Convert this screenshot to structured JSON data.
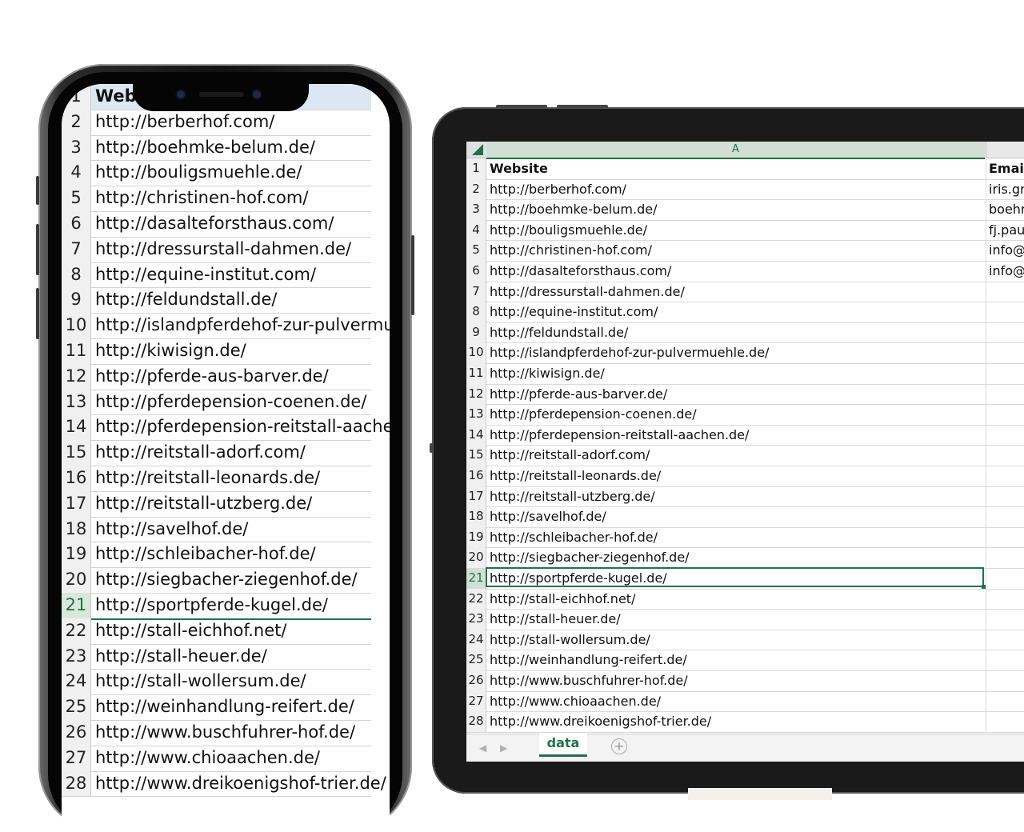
{
  "spreadsheet": {
    "column_letter": "A",
    "header": {
      "row": "1",
      "website": "Website",
      "email": "Email"
    },
    "rows": [
      {
        "num": "2",
        "website": "http://berberhof.com/",
        "email": "iris.gr"
      },
      {
        "num": "3",
        "website": "http://boehmke-belum.de/",
        "email": "boehr"
      },
      {
        "num": "4",
        "website": "http://bouligsmuehle.de/",
        "email": "fj.pau"
      },
      {
        "num": "5",
        "website": "http://christinen-hof.com/",
        "email": "info@"
      },
      {
        "num": "6",
        "website": "http://dasalteforsthaus.com/",
        "email": "info@"
      },
      {
        "num": "7",
        "website": "http://dressurstall-dahmen.de/",
        "email": ""
      },
      {
        "num": "8",
        "website": "http://equine-institut.com/",
        "email": ""
      },
      {
        "num": "9",
        "website": "http://feldundstall.de/",
        "email": ""
      },
      {
        "num": "10",
        "website": "http://islandpferdehof-zur-pulvermuehle.de/",
        "email": ""
      },
      {
        "num": "11",
        "website": "http://kiwisign.de/",
        "email": ""
      },
      {
        "num": "12",
        "website": "http://pferde-aus-barver.de/",
        "email": ""
      },
      {
        "num": "13",
        "website": "http://pferdepension-coenen.de/",
        "email": ""
      },
      {
        "num": "14",
        "website": "http://pferdepension-reitstall-aachen.de/",
        "email": ""
      },
      {
        "num": "15",
        "website": "http://reitstall-adorf.com/",
        "email": ""
      },
      {
        "num": "16",
        "website": "http://reitstall-leonards.de/",
        "email": ""
      },
      {
        "num": "17",
        "website": "http://reitstall-utzberg.de/",
        "email": ""
      },
      {
        "num": "18",
        "website": "http://savelhof.de/",
        "email": ""
      },
      {
        "num": "19",
        "website": "http://schleibacher-hof.de/",
        "email": ""
      },
      {
        "num": "20",
        "website": "http://siegbacher-ziegenhof.de/",
        "email": ""
      },
      {
        "num": "21",
        "website": "http://sportpferde-kugel.de/",
        "email": "",
        "active": true
      },
      {
        "num": "22",
        "website": "http://stall-eichhof.net/",
        "email": ""
      },
      {
        "num": "23",
        "website": "http://stall-heuer.de/",
        "email": ""
      },
      {
        "num": "24",
        "website": "http://stall-wollersum.de/",
        "email": ""
      },
      {
        "num": "25",
        "website": "http://weinhandlung-reifert.de/",
        "email": ""
      },
      {
        "num": "26",
        "website": "http://www.buschfuhrer-hof.de/",
        "email": ""
      },
      {
        "num": "27",
        "website": "http://www.chioaachen.de/",
        "email": ""
      },
      {
        "num": "28",
        "website": "http://www.dreikoenigshof-trier.de/",
        "email": ""
      }
    ],
    "sheet_tab": "data",
    "add_sheet_glyph": "+",
    "nav_prev": "◀",
    "nav_next": "▶",
    "accent_color": "#217346"
  }
}
